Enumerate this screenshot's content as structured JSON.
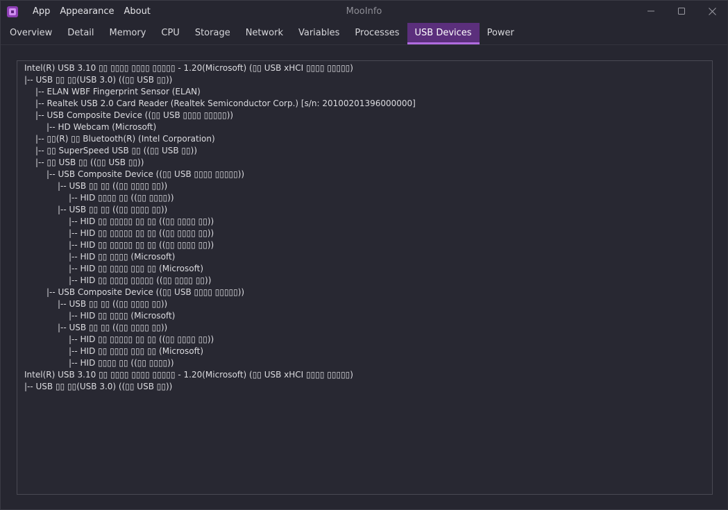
{
  "titlebar": {
    "title": "MooInfo",
    "menus": [
      "App",
      "Appearance",
      "About"
    ],
    "controls": [
      "minimize-icon",
      "maximize-icon",
      "close-icon"
    ]
  },
  "tabs": [
    {
      "label": "Overview",
      "active": false
    },
    {
      "label": "Detail",
      "active": false
    },
    {
      "label": "Memory",
      "active": false
    },
    {
      "label": "CPU",
      "active": false
    },
    {
      "label": "Storage",
      "active": false
    },
    {
      "label": "Network",
      "active": false
    },
    {
      "label": "Variables",
      "active": false
    },
    {
      "label": "Processes",
      "active": false
    },
    {
      "label": "USB Devices",
      "active": true
    },
    {
      "label": "Power",
      "active": false
    }
  ],
  "usb_tree": [
    {
      "depth": 0,
      "text": "Intel(R) USB 3.10 ▯▯ ▯▯▯▯ ▯▯▯▯ ▯▯▯▯▯ - 1.20(Microsoft) (▯▯ USB xHCI ▯▯▯▯ ▯▯▯▯▯)"
    },
    {
      "depth": 0,
      "text": "|-- USB ▯▯ ▯▯(USB 3.0) ((▯▯ USB ▯▯))"
    },
    {
      "depth": 1,
      "text": "|-- ELAN WBF Fingerprint Sensor (ELAN)"
    },
    {
      "depth": 1,
      "text": "|-- Realtek USB 2.0 Card Reader (Realtek Semiconductor Corp.) [s/n: 20100201396000000]"
    },
    {
      "depth": 1,
      "text": "|-- USB Composite Device ((▯▯ USB ▯▯▯▯ ▯▯▯▯▯))"
    },
    {
      "depth": 2,
      "text": "|-- HD Webcam (Microsoft)"
    },
    {
      "depth": 1,
      "text": "|-- ▯▯(R) ▯▯ Bluetooth(R) (Intel Corporation)"
    },
    {
      "depth": 1,
      "text": "|-- ▯▯ SuperSpeed USB ▯▯ ((▯▯ USB ▯▯))"
    },
    {
      "depth": 1,
      "text": "|-- ▯▯ USB ▯▯ ((▯▯ USB ▯▯))"
    },
    {
      "depth": 2,
      "text": "|-- USB Composite Device ((▯▯ USB ▯▯▯▯ ▯▯▯▯▯))"
    },
    {
      "depth": 3,
      "text": "|-- USB ▯▯ ▯▯ ((▯▯ ▯▯▯▯ ▯▯))"
    },
    {
      "depth": 4,
      "text": "|-- HID ▯▯▯▯ ▯▯ ((▯▯ ▯▯▯▯))"
    },
    {
      "depth": 3,
      "text": "|-- USB ▯▯ ▯▯ ((▯▯ ▯▯▯▯ ▯▯))"
    },
    {
      "depth": 4,
      "text": "|-- HID ▯▯ ▯▯▯▯▯ ▯▯ ▯▯ ((▯▯ ▯▯▯▯ ▯▯))"
    },
    {
      "depth": 4,
      "text": "|-- HID ▯▯ ▯▯▯▯▯ ▯▯ ▯▯ ((▯▯ ▯▯▯▯ ▯▯))"
    },
    {
      "depth": 4,
      "text": "|-- HID ▯▯ ▯▯▯▯▯ ▯▯ ▯▯ ((▯▯ ▯▯▯▯ ▯▯))"
    },
    {
      "depth": 4,
      "text": "|-- HID ▯▯ ▯▯▯▯ (Microsoft)"
    },
    {
      "depth": 4,
      "text": "|-- HID ▯▯ ▯▯▯▯ ▯▯▯ ▯▯ (Microsoft)"
    },
    {
      "depth": 4,
      "text": "|-- HID ▯▯ ▯▯▯▯ ▯▯▯▯▯ ((▯▯ ▯▯▯▯ ▯▯))"
    },
    {
      "depth": 2,
      "text": "|-- USB Composite Device ((▯▯ USB ▯▯▯▯ ▯▯▯▯▯))"
    },
    {
      "depth": 3,
      "text": "|-- USB ▯▯ ▯▯ ((▯▯ ▯▯▯▯ ▯▯))"
    },
    {
      "depth": 4,
      "text": "|-- HID ▯▯ ▯▯▯▯ (Microsoft)"
    },
    {
      "depth": 3,
      "text": "|-- USB ▯▯ ▯▯ ((▯▯ ▯▯▯▯ ▯▯))"
    },
    {
      "depth": 4,
      "text": "|-- HID ▯▯ ▯▯▯▯▯ ▯▯ ▯▯ ((▯▯ ▯▯▯▯ ▯▯))"
    },
    {
      "depth": 4,
      "text": "|-- HID ▯▯ ▯▯▯▯ ▯▯▯ ▯▯ (Microsoft)"
    },
    {
      "depth": 4,
      "text": "|-- HID ▯▯▯▯ ▯▯ ((▯▯ ▯▯▯▯))"
    },
    {
      "depth": 0,
      "text": "Intel(R) USB 3.10 ▯▯ ▯▯▯▯ ▯▯▯▯ ▯▯▯▯▯ - 1.20(Microsoft) (▯▯ USB xHCI ▯▯▯▯ ▯▯▯▯▯)"
    },
    {
      "depth": 0,
      "text": "|-- USB ▯▯ ▯▯(USB 3.0) ((▯▯ USB ▯▯))"
    }
  ],
  "colors": {
    "accent": "#b06ce0",
    "active_tab_bg": "#5b2f7c",
    "window_bg": "#262630",
    "text": "#dcdce0"
  }
}
